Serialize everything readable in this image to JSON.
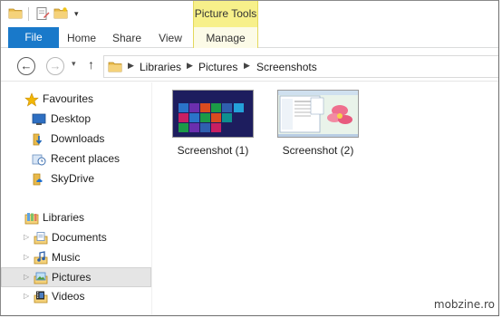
{
  "quick_access": {
    "icons": [
      "folder-icon",
      "properties-icon",
      "new-folder-icon",
      "customize-dropdown-icon"
    ],
    "dropdown_glyph": "▾"
  },
  "context_tab": {
    "label": "Picture Tools",
    "color": "#f7f08a"
  },
  "ribbon": {
    "file_label": "File",
    "file_color": "#1979ca",
    "tabs": [
      "Home",
      "Share",
      "View",
      "Manage"
    ]
  },
  "navigation": {
    "back_glyph": "←",
    "forward_glyph": "→",
    "history_glyph": "▾",
    "up_glyph": "↑",
    "breadcrumb": [
      "Libraries",
      "Pictures",
      "Screenshots"
    ],
    "separator_glyph": "▶"
  },
  "nav_pane": {
    "favourites": {
      "label": "Favourites",
      "icon": "star-icon",
      "items": [
        {
          "label": "Desktop",
          "icon": "desktop-icon"
        },
        {
          "label": "Downloads",
          "icon": "downloads-folder-icon"
        },
        {
          "label": "Recent places",
          "icon": "recent-places-icon"
        },
        {
          "label": "SkyDrive",
          "icon": "skydrive-folder-icon"
        }
      ]
    },
    "libraries": {
      "label": "Libraries",
      "icon": "libraries-icon",
      "items": [
        {
          "label": "Documents",
          "icon": "documents-library-icon"
        },
        {
          "label": "Music",
          "icon": "music-library-icon"
        },
        {
          "label": "Pictures",
          "icon": "pictures-library-icon",
          "selected": true
        },
        {
          "label": "Videos",
          "icon": "videos-library-icon"
        }
      ]
    },
    "expander_glyph": "▷"
  },
  "files": [
    {
      "name": "Screenshot (1)",
      "thumbnail": "windows-start-screen-thumbnail"
    },
    {
      "name": "Screenshot (2)",
      "thumbnail": "desktop-with-flower-thumbnail"
    }
  ],
  "watermark": "mobzine.ro"
}
